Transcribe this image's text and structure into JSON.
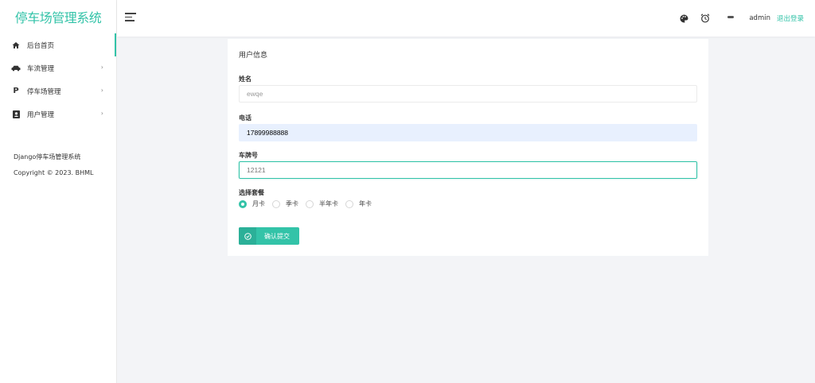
{
  "sidebar": {
    "brand": "停车场管理系统",
    "items": [
      {
        "label": "后台首页",
        "icon": "home-icon",
        "has_arrow": false
      },
      {
        "label": "车流管理",
        "icon": "car-icon",
        "has_arrow": true
      },
      {
        "label": "停车场管理",
        "icon": "parking-icon",
        "has_arrow": true
      },
      {
        "label": "用户管理",
        "icon": "user-card-icon",
        "has_arrow": true
      }
    ],
    "arrow": "›",
    "footer_line1": "Django停车场管理系统",
    "footer_line2": "Copyright © 2023. BHML"
  },
  "header": {
    "username": "admin",
    "logout": "退出登录"
  },
  "form": {
    "title": "用户信息",
    "name_label": "姓名",
    "name_value": "ewqe",
    "phone_label": "电话",
    "phone_value": "17899988888",
    "plate_label": "车牌号",
    "plate_value": "12121",
    "package_label": "选择套餐",
    "packages": [
      "月卡",
      "季卡",
      "半年卡",
      "年卡"
    ],
    "selected_package": "月卡",
    "submit": "确认提交"
  },
  "colors": {
    "accent": "#33c3a8",
    "autofill": "#e8f0fe",
    "background": "#f3f4f7"
  }
}
